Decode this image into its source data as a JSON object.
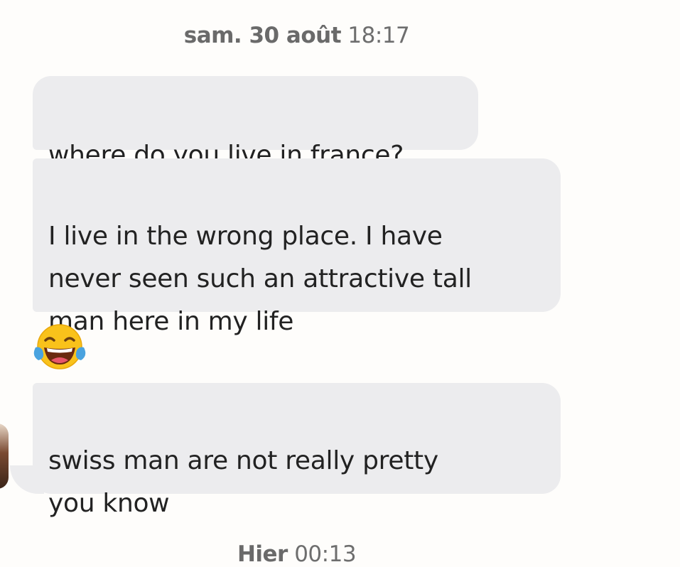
{
  "chat": {
    "timestamps": [
      {
        "day": "sam. 30 août",
        "time": "18:17"
      },
      {
        "day": "Hier",
        "time": "00:13"
      }
    ],
    "messages": [
      {
        "text": "where do you live in france?"
      },
      {
        "text": "I live in the wrong place. I have\nnever seen such an attractive tall\nman here in my life"
      },
      {
        "emoji": "face-with-tears-of-joy"
      },
      {
        "text": "swiss man are not really pretty\nyou know"
      }
    ]
  },
  "colors": {
    "background": "#fefdfb",
    "bubble": "#ececee",
    "text": "#222222",
    "timestamp": "#6e6e6e"
  }
}
